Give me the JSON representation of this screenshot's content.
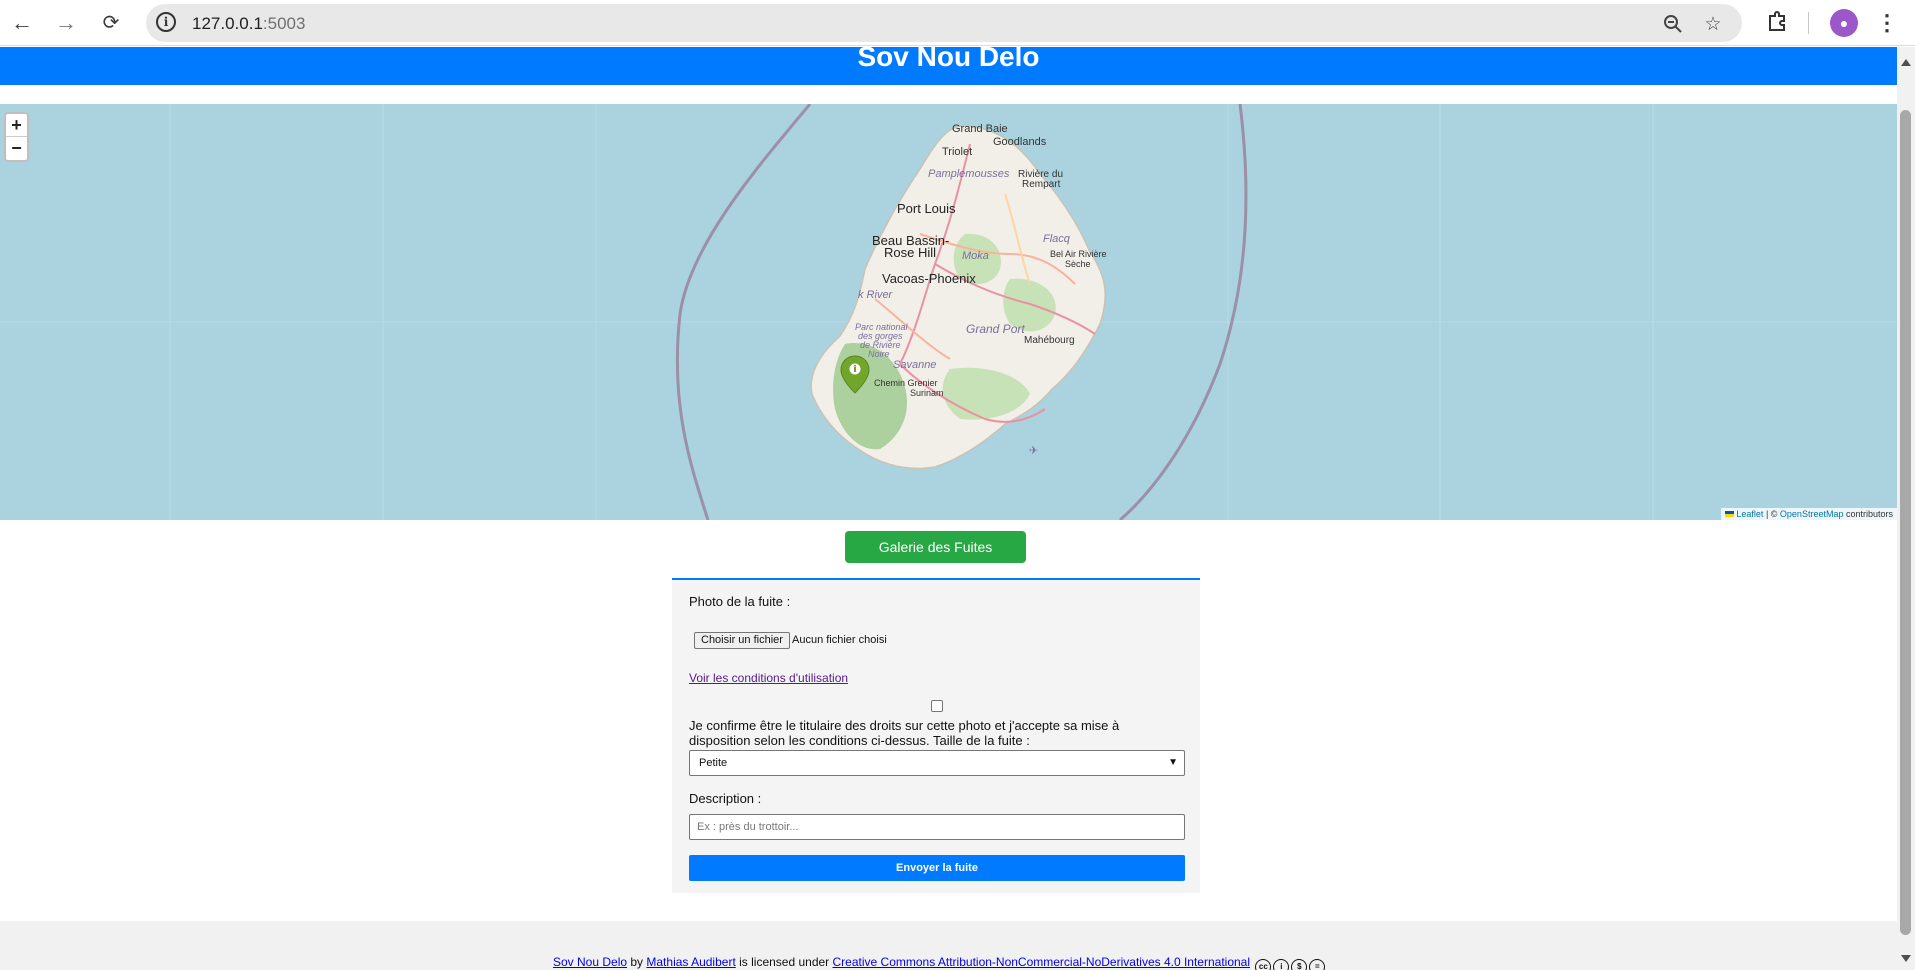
{
  "browser": {
    "url_host": "127.0.0.1",
    "url_port": ":5003",
    "back_icon": "arrow-left-icon",
    "forward_icon": "arrow-right-icon",
    "reload_icon": "reload-icon"
  },
  "header": {
    "title": "Sov Nou Delo"
  },
  "map": {
    "zoom_in": "+",
    "zoom_out": "−",
    "attribution_leaflet": "Leaflet",
    "attribution_sep": " | © ",
    "attribution_osm": "OpenStreetMap",
    "attribution_tail": " contributors",
    "labels": {
      "grand_baie": "Grand Baie",
      "goodlands": "Goodlands",
      "triolet": "Triolet",
      "pamplemousses": "Pamplemousses",
      "riviere_du_rempart_1": "Rivière du",
      "riviere_du_rempart_2": "Rempart",
      "port_louis": "Port Louis",
      "beau_bassin_1": "Beau Bassin-",
      "beau_bassin_2": "Rose Hill",
      "flacq": "Flacq",
      "moka": "Moka",
      "bel_air_1": "Bel Air Rivière",
      "bel_air_2": "Sèche",
      "vacoas": "Vacoas-Phoenix",
      "black_river": "k River",
      "parc_1": "Parc national",
      "parc_2": "des gorges",
      "parc_3": "de Rivière",
      "parc_4": "Noire",
      "grand_port": "Grand Port",
      "mahebourg": "Mahébourg",
      "savanne": "Savanne",
      "chemin_grenier": "Chemin Grenier",
      "surinam": "Surinam"
    }
  },
  "gallery_button": "Galerie des Fuites",
  "form": {
    "photo_label": "Photo de la fuite :",
    "file_button": "Choisir un fichier",
    "file_status": "Aucun fichier choisi",
    "terms_link": "Voir les conditions d'utilisation",
    "consent_text": "Je confirme être le titulaire des droits sur cette photo et j'accepte sa mise à disposition selon les conditions ci-dessus. Taille de la fuite :",
    "size_selected": "Petite",
    "description_label": "Description :",
    "description_placeholder": "Ex : près du trottoir...",
    "submit_label": "Envoyer la fuite"
  },
  "footer": {
    "project": "Sov Nou Delo",
    "by": " by ",
    "author": "Mathias Audibert",
    "licensed": " is licensed under ",
    "license": "Creative Commons Attribution-NonCommercial-NoDerivatives 4.0 International",
    "cc_icons": [
      "cc-icon",
      "by-icon",
      "nc-icon",
      "nd-icon"
    ]
  }
}
